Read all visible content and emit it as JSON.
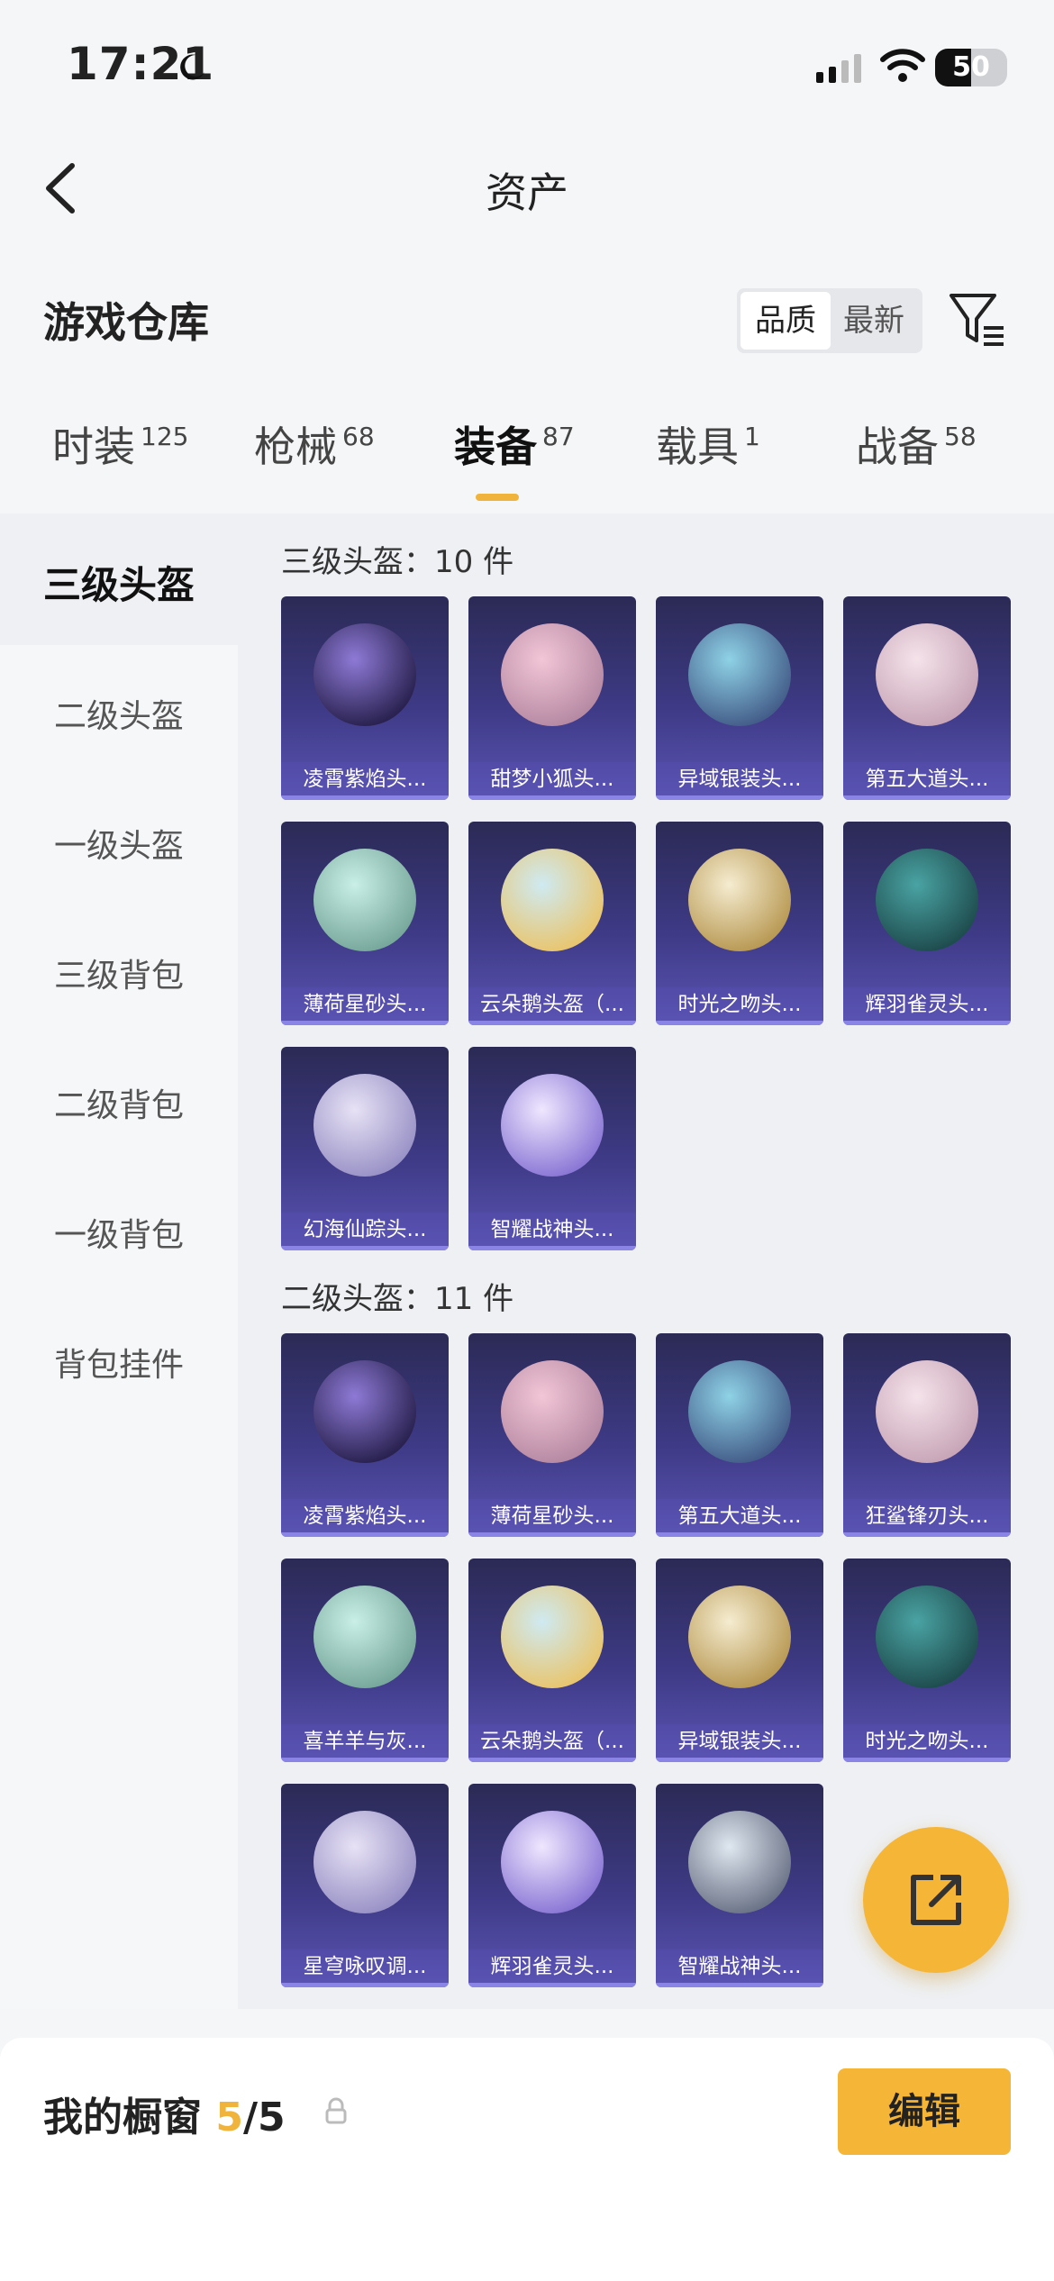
{
  "status_bar": {
    "time": "17:21",
    "battery": "50"
  },
  "nav": {
    "title": "资产"
  },
  "warehouse": {
    "title": "游戏仓库",
    "sort_options": [
      "品质",
      "最新"
    ]
  },
  "tabs": [
    {
      "label": "时装",
      "count": "125"
    },
    {
      "label": "枪械",
      "count": "68"
    },
    {
      "label": "装备",
      "count": "87"
    },
    {
      "label": "载具",
      "count": "1"
    },
    {
      "label": "战备",
      "count": "58"
    }
  ],
  "sidebar": [
    "三级头盔",
    "二级头盔",
    "一级头盔",
    "三级背包",
    "二级背包",
    "一级背包",
    "背包挂件"
  ],
  "sections": [
    {
      "title": "三级头盔：10 件",
      "items": [
        "凌霄紫焰头...",
        "甜梦小狐头...",
        "异域银装头...",
        "第五大道头...",
        "薄荷星砂头...",
        "云朵鹅头盔（...",
        "时光之吻头...",
        "辉羽雀灵头...",
        "幻海仙踪头...",
        "智耀战神头..."
      ]
    },
    {
      "title": "二级头盔：11 件",
      "items": [
        "凌霄紫焰头...",
        "薄荷星砂头...",
        "第五大道头...",
        "狂鲨锋刃头...",
        "喜羊羊与灰...",
        "云朵鹅头盔（...",
        "异域银装头...",
        "时光之吻头...",
        "星穹咏叹调...",
        "辉羽雀灵头...",
        "智耀战神头..."
      ]
    }
  ],
  "bottom": {
    "label": "我的橱窗",
    "count": "5",
    "total": "/5",
    "edit": "编辑"
  },
  "icons": {
    "back": "chevron-left-icon",
    "filter": "filter-icon",
    "share": "share-icon",
    "lock": "lock-icon"
  },
  "colors": {
    "accent": "#f5b536",
    "card": "#3e3a86"
  }
}
